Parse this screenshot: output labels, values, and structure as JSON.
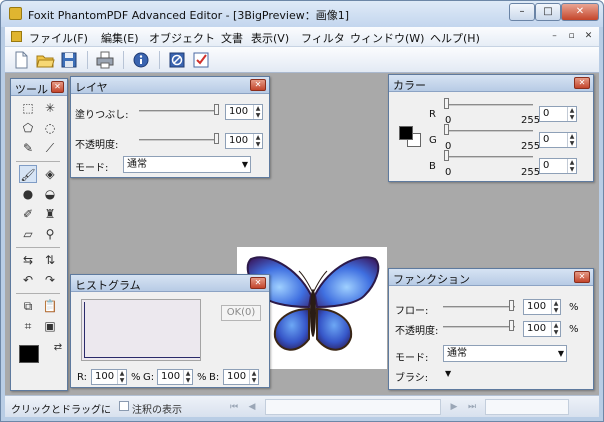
{
  "window": {
    "title": "Foxit PhantomPDF Advanced Editor - [3BigPreview：画像1]",
    "controls": {
      "minimize": "–",
      "maximize": "□",
      "close": "✕"
    }
  },
  "menubar": {
    "items": [
      "ファイル(F)",
      "編集(E)",
      "オブジェクト",
      "文書",
      "表示(V)",
      "フィルタ",
      "ウィンドウ(W)",
      "ヘルプ(H)"
    ],
    "mdi_controls": [
      "–",
      "▫",
      "✕"
    ]
  },
  "toolbar": {
    "icons": [
      "new-document-icon",
      "open-folder-icon",
      "save-disk-icon",
      "print-icon",
      "info-icon",
      "no-entry-icon",
      "checkbox-icon"
    ]
  },
  "panels": {
    "tools": {
      "title": "ツール"
    },
    "layer": {
      "title": "レイヤ",
      "fill_label": "塗りつぶし:",
      "fill_value": "100",
      "opacity_label": "不透明度:",
      "opacity_value": "100",
      "mode_label": "モード:",
      "mode_value": "通常"
    },
    "color": {
      "title": "カラー",
      "channels": [
        {
          "name": "R",
          "min": "0",
          "max": "255",
          "value": "0"
        },
        {
          "name": "G",
          "min": "0",
          "max": "255",
          "value": "0"
        },
        {
          "name": "B",
          "min": "0",
          "max": "255",
          "value": "0"
        }
      ],
      "foreground": "#000000",
      "background": "#ffffff"
    },
    "histogram": {
      "title": "ヒストグラム",
      "ok_label": "OK(0)",
      "r_label": "R:",
      "r_value": "100",
      "g_label": "G:",
      "g_value": "100",
      "b_label": "B:",
      "b_value": "100",
      "percent": "%"
    },
    "function": {
      "title": "ファンクション",
      "flow_label": "フロー:",
      "flow_value": "100",
      "opacity_label": "不透明度:",
      "opacity_value": "100",
      "percent": "%",
      "mode_label": "モード:",
      "mode_value": "通常",
      "brush_label": "ブラシ:"
    }
  },
  "statusbar": {
    "text": "クリックとドラッグに",
    "check_label": "注釈の表示"
  },
  "colors": {
    "title_bar": "#c3d6ee",
    "workspace": "#a9a9a9",
    "close_red": "#c4452a"
  }
}
